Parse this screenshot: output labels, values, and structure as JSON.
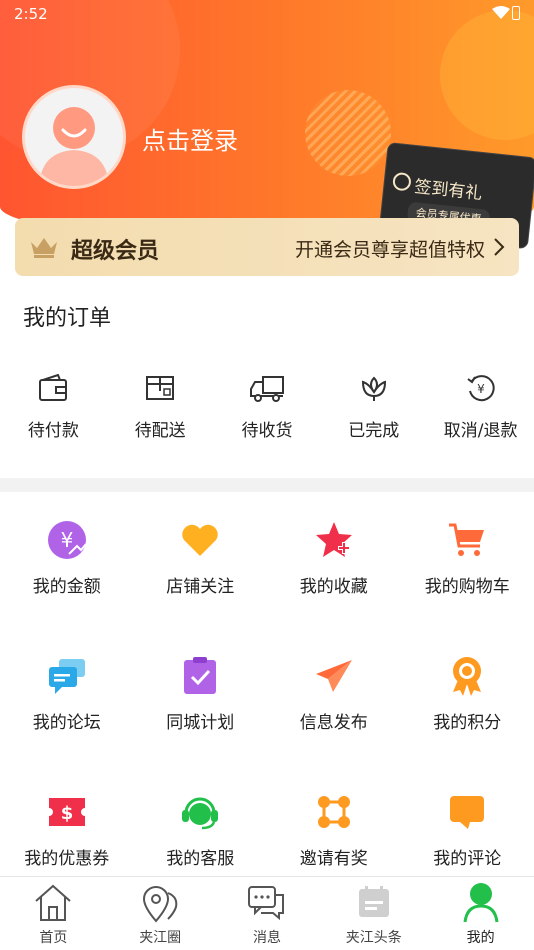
{
  "status_bar": {
    "time": "2:52"
  },
  "profile": {
    "login_text": "点击登录"
  },
  "signin_card": {
    "title": "签到有礼",
    "tag": "会员专属优惠"
  },
  "vip": {
    "title": "超级会员",
    "subtitle": "开通会员尊享超值特权"
  },
  "orders": {
    "title": "我的订单",
    "items": [
      {
        "label": "待付款",
        "icon": "wallet-icon"
      },
      {
        "label": "待配送",
        "icon": "package-icon"
      },
      {
        "label": "待收货",
        "icon": "truck-icon"
      },
      {
        "label": "已完成",
        "icon": "lotus-icon"
      },
      {
        "label": "取消/退款",
        "icon": "refund-icon"
      }
    ]
  },
  "services": [
    {
      "label": "我的金额",
      "icon": "yuan-icon",
      "color": "#b163e8"
    },
    {
      "label": "店铺关注",
      "icon": "heart-icon",
      "color": "#ffb020"
    },
    {
      "label": "我的收藏",
      "icon": "star-icon",
      "color": "#f0304a"
    },
    {
      "label": "我的购物车",
      "icon": "cart-icon",
      "color": "#ff6a3a"
    },
    {
      "label": "我的论坛",
      "icon": "chat-icon",
      "color": "#2aa8e8"
    },
    {
      "label": "同城计划",
      "icon": "clipboard-icon",
      "color": "#b163e8"
    },
    {
      "label": "信息发布",
      "icon": "paper-plane-icon",
      "color": "#ff6a3a"
    },
    {
      "label": "我的积分",
      "icon": "medal-icon",
      "color": "#ff9a20"
    },
    {
      "label": "我的优惠券",
      "icon": "coupon-icon",
      "color": "#f0304a"
    },
    {
      "label": "我的客服",
      "icon": "headset-icon",
      "color": "#22c04a"
    },
    {
      "label": "邀请有奖",
      "icon": "network-icon",
      "color": "#ff9a20"
    },
    {
      "label": "我的评论",
      "icon": "comment-icon",
      "color": "#ff9a20"
    }
  ],
  "tabs": [
    {
      "label": "首页",
      "icon": "home-icon"
    },
    {
      "label": "夹江圈",
      "icon": "location-icon"
    },
    {
      "label": "消息",
      "icon": "message-icon"
    },
    {
      "label": "夹江头条",
      "icon": "news-icon"
    },
    {
      "label": "我的",
      "icon": "user-icon",
      "active": true
    }
  ]
}
